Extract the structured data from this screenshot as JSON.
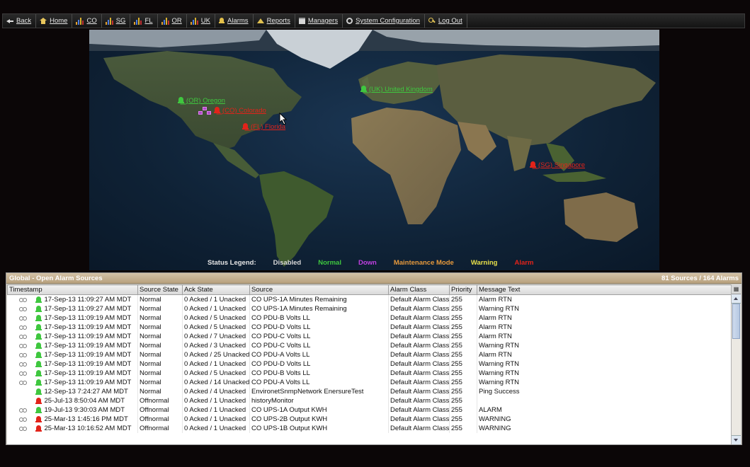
{
  "nav": {
    "back": "Back",
    "home": "Home",
    "co": "CO",
    "sg": "SG",
    "fl": "FL",
    "or": "OR",
    "uk": "UK",
    "alarms": "Alarms",
    "reports": "Reports",
    "managers": "Managers",
    "system_configuration": "System Configuration",
    "logout": "Log Out"
  },
  "map": {
    "sites": {
      "oregon": {
        "label": "(OR) Oregon",
        "status": "normal"
      },
      "colorado": {
        "label": "(CO) Colorado",
        "status": "alarm"
      },
      "florida": {
        "label": "(FL) Florida",
        "status": "alarm"
      },
      "uk": {
        "label": "(UK) United Kingdom",
        "status": "normal"
      },
      "singapore": {
        "label": "(SG) Singapore",
        "status": "alarm"
      }
    }
  },
  "legend": {
    "title": "Status Legend:",
    "disabled": "Disabled",
    "normal": "Normal",
    "down": "Down",
    "maintenance": "Maintenance Mode",
    "warning": "Warning",
    "alarm": "Alarm"
  },
  "colors": {
    "normal": "#3fc73f",
    "alarm": "#e2231a",
    "down": "#c040e0",
    "maintenance": "#e89a3c",
    "warning": "#e8e04a",
    "disabled": "#d8d8d8"
  },
  "panel": {
    "title": "Global - Open Alarm Sources",
    "summary": "81 Sources / 164 Alarms",
    "columns": [
      "Timestamp",
      "Source State",
      "Ack State",
      "Source",
      "Alarm Class",
      "Priority",
      "Message Text"
    ],
    "rows": [
      {
        "linked": true,
        "bell": "normal",
        "timestamp": "17-Sep-13 11:09:27 AM MDT",
        "source_state": "Normal",
        "ack_state": "0 Acked / 1 Unacked",
        "source": "CO UPS-1A Minutes Remaining",
        "alarm_class": "Default Alarm Class",
        "priority": "255",
        "message": "Alarm RTN"
      },
      {
        "linked": true,
        "bell": "normal",
        "timestamp": "17-Sep-13 11:09:27 AM MDT",
        "source_state": "Normal",
        "ack_state": "0 Acked / 1 Unacked",
        "source": "CO UPS-1A Minutes Remaining",
        "alarm_class": "Default Alarm Class",
        "priority": "255",
        "message": "Warning RTN"
      },
      {
        "linked": true,
        "bell": "normal",
        "timestamp": "17-Sep-13 11:09:19 AM MDT",
        "source_state": "Normal",
        "ack_state": "0 Acked / 5 Unacked",
        "source": "CO PDU-B Volts LL",
        "alarm_class": "Default Alarm Class",
        "priority": "255",
        "message": "Alarm RTN"
      },
      {
        "linked": true,
        "bell": "normal",
        "timestamp": "17-Sep-13 11:09:19 AM MDT",
        "source_state": "Normal",
        "ack_state": "0 Acked / 5 Unacked",
        "source": "CO PDU-D Volts LL",
        "alarm_class": "Default Alarm Class",
        "priority": "255",
        "message": "Alarm RTN"
      },
      {
        "linked": true,
        "bell": "normal",
        "timestamp": "17-Sep-13 11:09:19 AM MDT",
        "source_state": "Normal",
        "ack_state": "0 Acked / 7 Unacked",
        "source": "CO PDU-C Volts LL",
        "alarm_class": "Default Alarm Class",
        "priority": "255",
        "message": "Alarm RTN"
      },
      {
        "linked": true,
        "bell": "normal",
        "timestamp": "17-Sep-13 11:09:19 AM MDT",
        "source_state": "Normal",
        "ack_state": "0 Acked / 3 Unacked",
        "source": "CO PDU-C Volts LL",
        "alarm_class": "Default Alarm Class",
        "priority": "255",
        "message": "Warning RTN"
      },
      {
        "linked": true,
        "bell": "normal",
        "timestamp": "17-Sep-13 11:09:19 AM MDT",
        "source_state": "Normal",
        "ack_state": "0 Acked / 25 Unacked",
        "source": "CO PDU-A Volts LL",
        "alarm_class": "Default Alarm Class",
        "priority": "255",
        "message": "Alarm RTN"
      },
      {
        "linked": true,
        "bell": "normal",
        "timestamp": "17-Sep-13 11:09:19 AM MDT",
        "source_state": "Normal",
        "ack_state": "0 Acked / 1 Unacked",
        "source": "CO PDU-D Volts LL",
        "alarm_class": "Default Alarm Class",
        "priority": "255",
        "message": "Warning RTN"
      },
      {
        "linked": true,
        "bell": "normal",
        "timestamp": "17-Sep-13 11:09:19 AM MDT",
        "source_state": "Normal",
        "ack_state": "0 Acked / 5 Unacked",
        "source": "CO PDU-B Volts LL",
        "alarm_class": "Default Alarm Class",
        "priority": "255",
        "message": "Warning RTN"
      },
      {
        "linked": true,
        "bell": "normal",
        "timestamp": "17-Sep-13 11:09:19 AM MDT",
        "source_state": "Normal",
        "ack_state": "0 Acked / 14 Unacked",
        "source": "CO PDU-A Volts LL",
        "alarm_class": "Default Alarm Class",
        "priority": "255",
        "message": "Warning RTN"
      },
      {
        "linked": false,
        "bell": "normal",
        "timestamp": "12-Sep-13 7:24:27 AM MDT",
        "source_state": "Normal",
        "ack_state": "0 Acked / 4 Unacked",
        "source": "EnvironetSnmpNetwork EnersureTest",
        "alarm_class": "Default Alarm Class",
        "priority": "255",
        "message": "Ping Success"
      },
      {
        "linked": false,
        "bell": "alarm",
        "timestamp": "25-Jul-13 8:50:04 AM MDT",
        "source_state": "Offnormal",
        "ack_state": "0 Acked / 1 Unacked",
        "source": "historyMonitor",
        "alarm_class": "Default Alarm Class",
        "priority": "255",
        "message": ""
      },
      {
        "linked": true,
        "bell": "normal",
        "timestamp": "19-Jul-13 9:30:03 AM MDT",
        "source_state": "Offnormal",
        "ack_state": "0 Acked / 1 Unacked",
        "source": "CO UPS-1A Output KWH",
        "alarm_class": "Default Alarm Class",
        "priority": "255",
        "message": "ALARM"
      },
      {
        "linked": true,
        "bell": "alarm",
        "timestamp": "25-Mar-13 1:45:16 PM MDT",
        "source_state": "Offnormal",
        "ack_state": "0 Acked / 1 Unacked",
        "source": "CO UPS-2B Output KWH",
        "alarm_class": "Default Alarm Class",
        "priority": "255",
        "message": "WARNING"
      },
      {
        "linked": true,
        "bell": "alarm",
        "timestamp": "25-Mar-13 10:16:52 AM MDT",
        "source_state": "Offnormal",
        "ack_state": "0 Acked / 1 Unacked",
        "source": "CO UPS-1B Output KWH",
        "alarm_class": "Default Alarm Class",
        "priority": "255",
        "message": "WARNING"
      }
    ]
  }
}
